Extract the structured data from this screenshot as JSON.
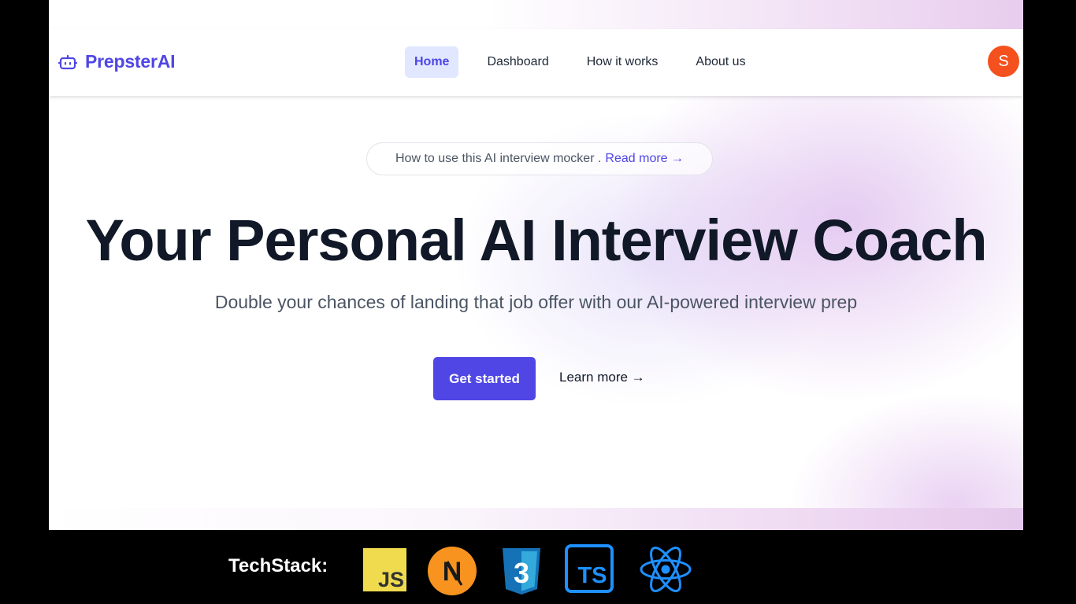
{
  "brand": {
    "name": "PrepsterAI",
    "icon": "robot-icon",
    "color": "#4f46e5"
  },
  "nav": {
    "items": [
      {
        "label": "Home",
        "active": true
      },
      {
        "label": "Dashboard",
        "active": false
      },
      {
        "label": "How it works",
        "active": false
      },
      {
        "label": "About us",
        "active": false
      }
    ]
  },
  "user": {
    "avatar_initial": "S",
    "avatar_color": "#f4511e"
  },
  "announcement": {
    "text": "How to use this AI interview mocker .",
    "link_label": "Read more →"
  },
  "hero": {
    "title": "Your Personal AI Interview Coach",
    "subtitle": "Double your chances of landing that job offer with our AI-powered interview prep",
    "primary_cta": "Get started",
    "secondary_cta": "Learn more →"
  },
  "techstack": {
    "label": "TechStack:",
    "logos": [
      {
        "name": "javascript-logo",
        "text": "JS"
      },
      {
        "name": "nextjs-logo",
        "text": "N"
      },
      {
        "name": "css3-logo",
        "text": "3"
      },
      {
        "name": "typescript-logo",
        "text": "TS"
      },
      {
        "name": "react-logo"
      }
    ]
  }
}
